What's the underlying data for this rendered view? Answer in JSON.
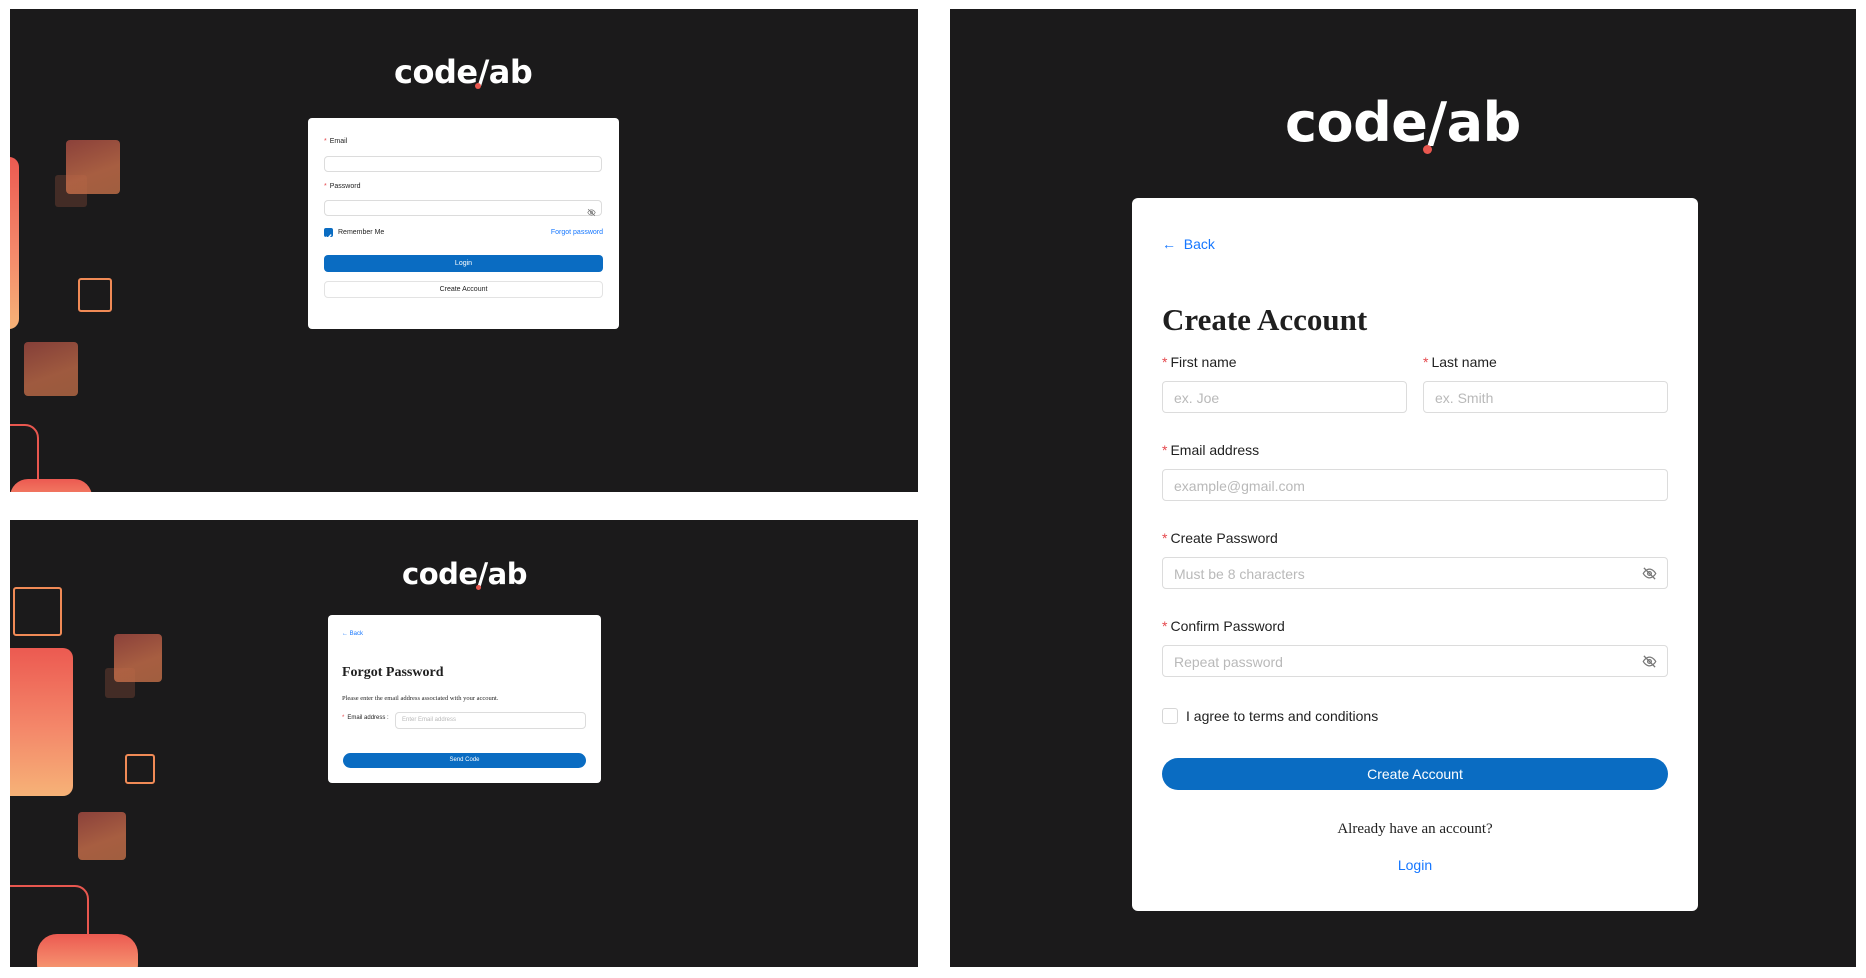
{
  "brand": {
    "logo_text_before": "code",
    "logo_slash": "/",
    "logo_text_after": "ab",
    "accent_color": "#e9574f",
    "primary_color": "#0a6cc2",
    "background_color": "#1b1a1b"
  },
  "login": {
    "email_label": "Email",
    "password_label": "Password",
    "remember_label": "Remember Me",
    "remember_checked": true,
    "forgot_link": "Forgot password",
    "login_button": "Login",
    "create_button": "Create Account",
    "icons": [
      "eye-off-icon",
      "checkbox-checked-icon"
    ]
  },
  "forgot": {
    "back_label": "Back",
    "title": "Forgot Password",
    "description": "Please enter the email address associated with your account.",
    "email_label": "Email address :",
    "email_placeholder": "Enter Email address",
    "send_button": "Send Code",
    "icons": [
      "arrow-left-icon"
    ]
  },
  "create": {
    "back_label": "Back",
    "title": "Create Account",
    "first_name_label": "First name",
    "first_name_placeholder": "ex. Joe",
    "last_name_label": "Last name",
    "last_name_placeholder": "ex. Smith",
    "email_label": "Email address",
    "email_placeholder": "example@gmail.com",
    "password_label": "Create Password",
    "password_placeholder": "Must be 8 characters",
    "confirm_label": "Confirm Password",
    "confirm_placeholder": "Repeat password",
    "terms_label": "I agree to terms and conditions",
    "terms_checked": false,
    "submit_button": "Create Account",
    "have_account_text": "Already have an account?",
    "login_link": "Login",
    "icons": [
      "arrow-left-icon",
      "eye-off-icon"
    ]
  }
}
